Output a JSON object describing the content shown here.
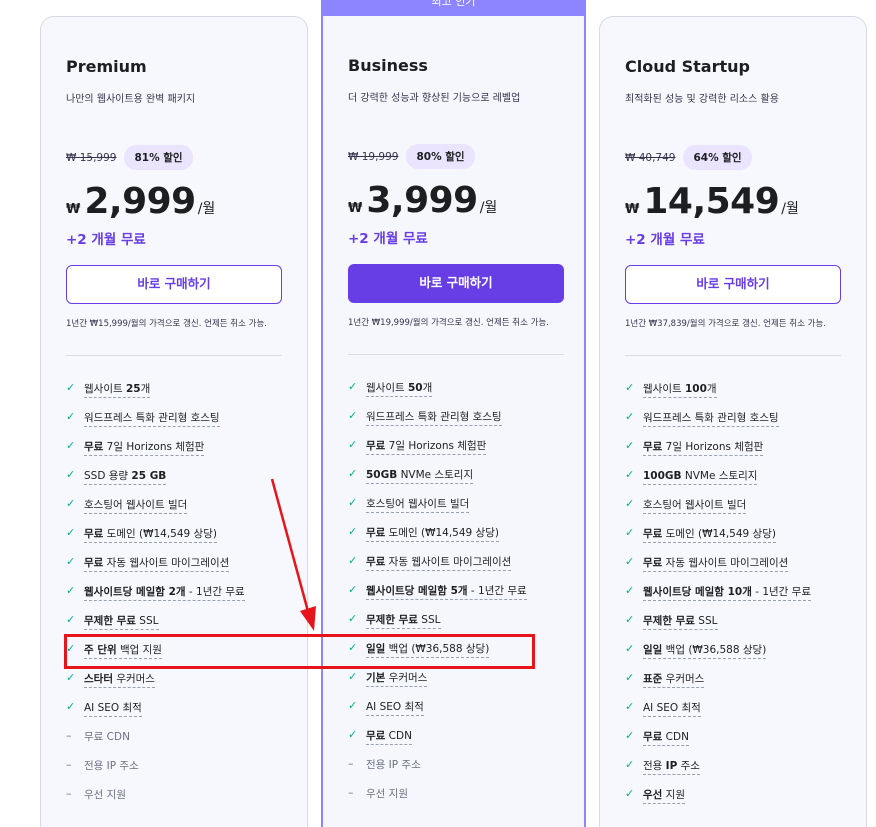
{
  "banner": {
    "label": "최고 인기"
  },
  "plans": [
    {
      "name": "Premium",
      "desc": "나만의 웹사이트용 완벽 패키지",
      "old_price": "₩ 15,999",
      "discount": "81% 할인",
      "currency": "₩",
      "price": "2,999",
      "per": "/월",
      "free": "+2 개월 무료",
      "button": "바로 구매하기",
      "renew": "1년간 ₩15,999/월의 가격으로 갱신. 언제든 취소 가능.",
      "features": [
        {
          "on": true,
          "pre": "웹사이트 ",
          "b": "25",
          "post": "개"
        },
        {
          "on": true,
          "pre": "워드프레스 특화 관리형 호스팅",
          "b": "",
          "post": ""
        },
        {
          "on": true,
          "pre": "",
          "b": "무료",
          "post": " 7일 Horizons 체험판"
        },
        {
          "on": true,
          "pre": "SSD 용량 ",
          "b": "25 GB",
          "post": ""
        },
        {
          "on": true,
          "pre": "호스팅어 웹사이트 빌더",
          "b": "",
          "post": ""
        },
        {
          "on": true,
          "pre": "",
          "b": "무료",
          "post": " 도메인 (₩14,549 상당)"
        },
        {
          "on": true,
          "pre": "",
          "b": "무료",
          "post": " 자동 웹사이트 마이그레이션"
        },
        {
          "on": true,
          "pre": "",
          "b": "웹사이트당 메일함 2개",
          "post": " - 1년간 무료"
        },
        {
          "on": true,
          "pre": "",
          "b": "무제한 무료",
          "post": " SSL"
        },
        {
          "on": true,
          "pre": "",
          "b": "주 단위",
          "post": " 백업 지원"
        },
        {
          "on": true,
          "pre": "",
          "b": "스타터",
          "post": " 우커머스"
        },
        {
          "on": true,
          "pre": "AI SEO 최적",
          "b": "",
          "post": ""
        },
        {
          "on": false,
          "pre": "무료 CDN",
          "b": "",
          "post": ""
        },
        {
          "on": false,
          "pre": "전용 IP 주소",
          "b": "",
          "post": ""
        },
        {
          "on": false,
          "pre": "우선 지원",
          "b": "",
          "post": ""
        }
      ]
    },
    {
      "name": "Business",
      "desc": "더 강력한 성능과 향상된 기능으로 레벨업",
      "old_price": "₩ 19,999",
      "discount": "80% 할인",
      "currency": "₩",
      "price": "3,999",
      "per": "/월",
      "free": "+2 개월 무료",
      "button": "바로 구매하기",
      "renew": "1년간 ₩19,999/월의 가격으로 갱신. 언제든 취소 가능.",
      "features": [
        {
          "on": true,
          "pre": "웹사이트 ",
          "b": "50",
          "post": "개"
        },
        {
          "on": true,
          "pre": "워드프레스 특화 관리형 호스팅",
          "b": "",
          "post": ""
        },
        {
          "on": true,
          "pre": "",
          "b": "무료",
          "post": " 7일 Horizons 체험판"
        },
        {
          "on": true,
          "pre": "",
          "b": "50GB",
          "post": " NVMe 스토리지"
        },
        {
          "on": true,
          "pre": "호스팅어 웹사이트 빌더",
          "b": "",
          "post": ""
        },
        {
          "on": true,
          "pre": "",
          "b": "무료",
          "post": " 도메인 (₩14,549 상당)"
        },
        {
          "on": true,
          "pre": "",
          "b": "무료",
          "post": " 자동 웹사이트 마이그레이션"
        },
        {
          "on": true,
          "pre": "",
          "b": "웹사이트당 메일함 5개",
          "post": " - 1년간 무료"
        },
        {
          "on": true,
          "pre": "",
          "b": "무제한 무료",
          "post": " SSL"
        },
        {
          "on": true,
          "pre": "",
          "b": "일일",
          "post": " 백업 (₩36,588 상당)"
        },
        {
          "on": true,
          "pre": "",
          "b": "기본",
          "post": " 우커머스"
        },
        {
          "on": true,
          "pre": "AI SEO 최적",
          "b": "",
          "post": ""
        },
        {
          "on": true,
          "pre": "",
          "b": "무료",
          "post": " CDN"
        },
        {
          "on": false,
          "pre": "전용 IP 주소",
          "b": "",
          "post": ""
        },
        {
          "on": false,
          "pre": "우선 지원",
          "b": "",
          "post": ""
        }
      ]
    },
    {
      "name": "Cloud Startup",
      "desc": "최적화된 성능 및 강력한 리소스 활용",
      "old_price": "₩ 40,749",
      "discount": "64% 할인",
      "currency": "₩",
      "price": "14,549",
      "per": "/월",
      "free": "+2 개월 무료",
      "button": "바로 구매하기",
      "renew": "1년간 ₩37,839/월의 가격으로 갱신. 언제든 취소 가능.",
      "features": [
        {
          "on": true,
          "pre": "웹사이트 ",
          "b": "100",
          "post": "개"
        },
        {
          "on": true,
          "pre": "워드프레스 특화 관리형 호스팅",
          "b": "",
          "post": ""
        },
        {
          "on": true,
          "pre": "",
          "b": "무료",
          "post": " 7일 Horizons 체험판"
        },
        {
          "on": true,
          "pre": "",
          "b": "100GB",
          "post": " NVMe 스토리지"
        },
        {
          "on": true,
          "pre": "호스팅어 웹사이트 빌더",
          "b": "",
          "post": ""
        },
        {
          "on": true,
          "pre": "",
          "b": "무료",
          "post": " 도메인 (₩14,549 상당)"
        },
        {
          "on": true,
          "pre": "",
          "b": "무료",
          "post": " 자동 웹사이트 마이그레이션"
        },
        {
          "on": true,
          "pre": "",
          "b": "웹사이트당 메일함 10개",
          "post": " - 1년간 무료"
        },
        {
          "on": true,
          "pre": "",
          "b": "무제한 무료",
          "post": " SSL"
        },
        {
          "on": true,
          "pre": "",
          "b": "일일",
          "post": " 백업 (₩36,588 상당)"
        },
        {
          "on": true,
          "pre": "",
          "b": "표준",
          "post": " 우커머스"
        },
        {
          "on": true,
          "pre": "AI SEO 최적",
          "b": "",
          "post": ""
        },
        {
          "on": true,
          "pre": "",
          "b": "무료",
          "post": " CDN"
        },
        {
          "on": true,
          "pre": "전용 ",
          "b": "IP",
          "post": " 주소"
        },
        {
          "on": true,
          "pre": "",
          "b": "우선",
          "post": " 지원"
        }
      ]
    }
  ],
  "icons": {
    "check": "check-icon",
    "dash": "dash-icon"
  },
  "colors": {
    "accent": "#673de6",
    "check": "#00b090",
    "highlight": "#e8141c",
    "banner": "#8c85ff"
  }
}
